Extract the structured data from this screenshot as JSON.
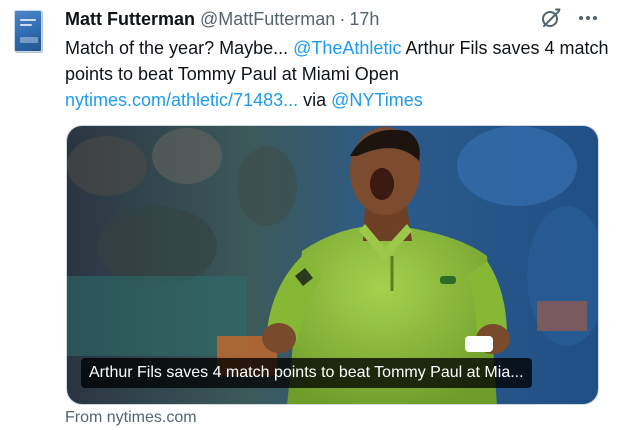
{
  "author": {
    "name": "Matt Futterman",
    "handle": "@MattFutterman",
    "separator": "·",
    "time": "17h"
  },
  "tweet": {
    "text_part1": "Match of the year? Maybe... ",
    "mention_athletic": "@TheAthletic",
    "text_part2": " Arthur Fils saves 4 match points to beat Tommy Paul at Miami Open",
    "link": "nytimes.com/athletic/71483...",
    "via": " via ",
    "mention_nyt": "@NYTimes"
  },
  "card": {
    "caption": "Arthur Fils saves 4 match points to beat Tommy Paul at Mia...",
    "source": "From nytimes.com"
  },
  "icons": {
    "grok": "grok-icon",
    "more": "more-options-icon"
  },
  "colors": {
    "link": "#1d9bf0",
    "secondary_text": "#536471",
    "shirt": "#8bbd3a"
  }
}
